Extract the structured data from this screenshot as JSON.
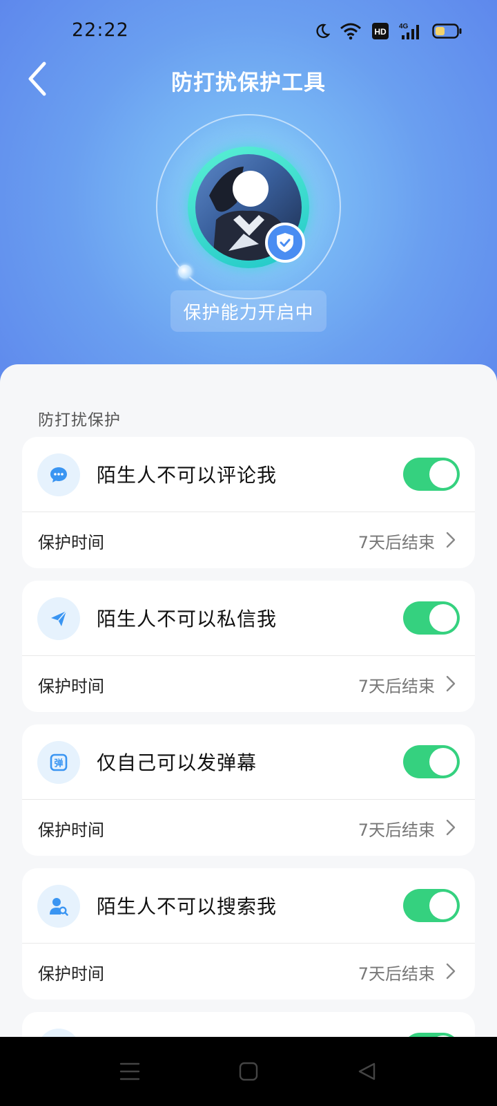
{
  "status_bar": {
    "time": "22:22",
    "icons": [
      "moon-icon",
      "wifi-icon",
      "hd-icon",
      "signal-4g-icon",
      "battery-icon"
    ],
    "hd_label": "HD",
    "network_label": "4G",
    "battery_color": "#f3d36b"
  },
  "header": {
    "title": "防打扰保护工具",
    "back_icon": "chevron-left-icon"
  },
  "protection": {
    "status_text": "保护能力开启中",
    "badge_icon": "shield-check-icon"
  },
  "section": {
    "title": "防打扰保护"
  },
  "features": [
    {
      "icon": "comment-icon",
      "label": "陌生人不可以评论我",
      "enabled": true,
      "time_label": "保护时间",
      "time_value": "7天后结束"
    },
    {
      "icon": "send-icon",
      "label": "陌生人不可以私信我",
      "enabled": true,
      "time_label": "保护时间",
      "time_value": "7天后结束"
    },
    {
      "icon": "danmaku-icon",
      "icon_text": "弹",
      "label": "仅自己可以发弹幕",
      "enabled": true,
      "time_label": "保护时间",
      "time_value": "7天后结束"
    },
    {
      "icon": "user-search-icon",
      "label": "陌生人不可以搜索我",
      "enabled": true,
      "time_label": "保护时间",
      "time_value": "7天后结束"
    }
  ],
  "colors": {
    "toggle_on": "#35d17f",
    "accent_blue": "#4a8df2",
    "icon_bg": "#e6f2fd"
  },
  "system_nav": [
    "menu-icon",
    "home-icon",
    "back-triangle-icon"
  ]
}
